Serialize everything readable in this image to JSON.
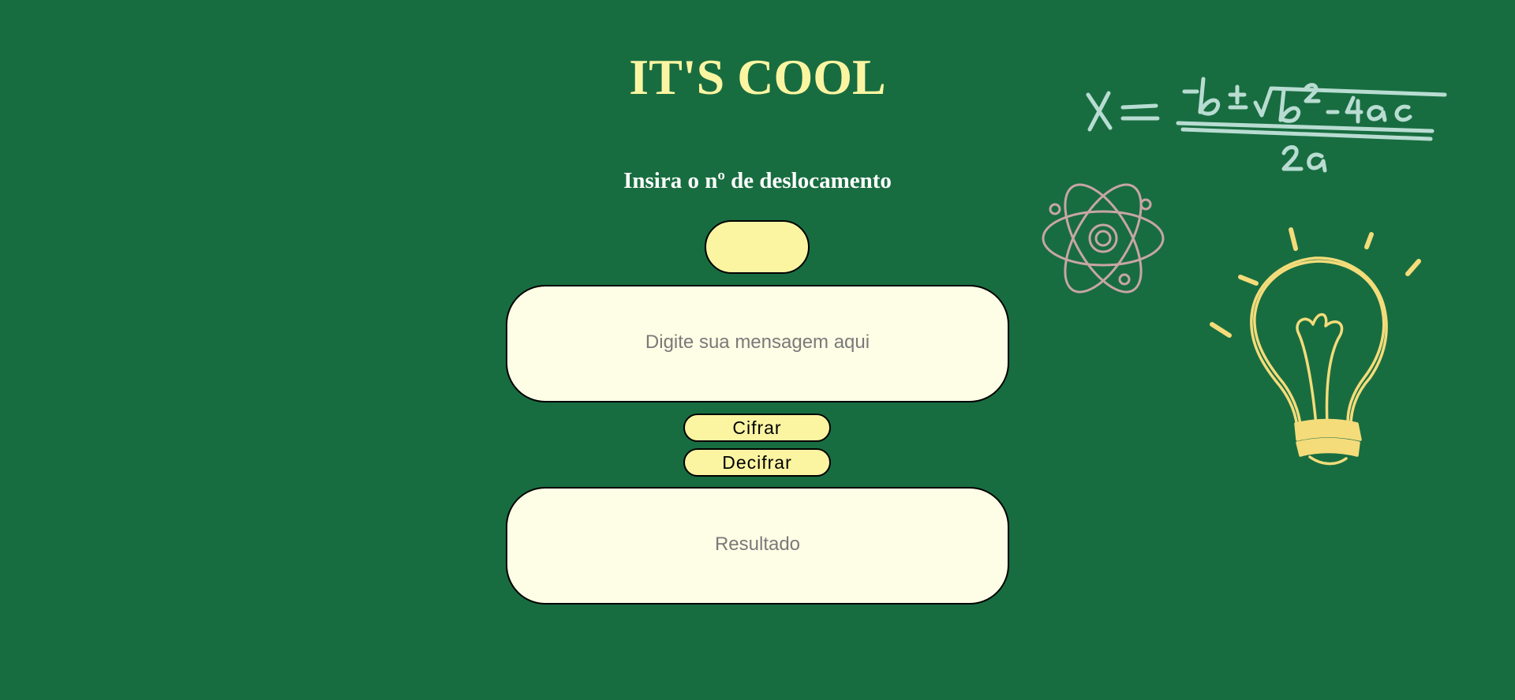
{
  "page": {
    "title": "IT'S COOL",
    "subtitle": "Insira o nº de deslocamento"
  },
  "form": {
    "shift_value": "",
    "message_placeholder": "Digite sua mensagem aqui",
    "encrypt_label": "Cifrar",
    "decrypt_label": "Decifrar",
    "result_placeholder": "Resultado"
  },
  "decor": {
    "formula_icon": "quadratic-formula-drawing",
    "atom_icon": "atom-drawing",
    "lightbulb_icon": "lightbulb-drawing"
  },
  "colors": {
    "background": "#186d40",
    "accent_yellow": "#fbf5a2",
    "box_cream": "#fefde5",
    "formula_chalk": "#b8dcd2",
    "atom_chalk": "#c7a6a4",
    "bulb_yellow": "#f4dc7a"
  }
}
